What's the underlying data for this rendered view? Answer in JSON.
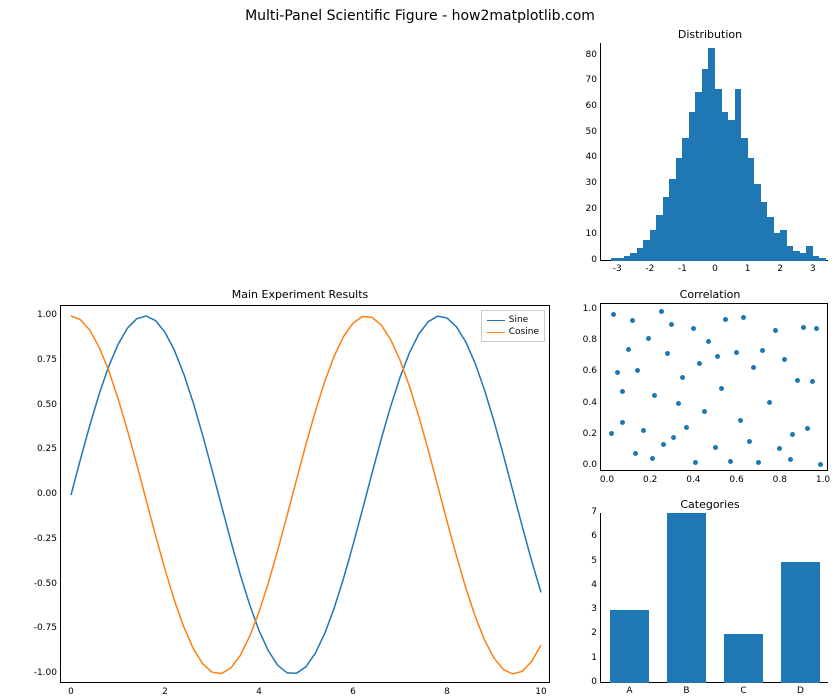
{
  "suptitle": "Multi-Panel Scientific Figure - how2matplotlib.com",
  "chart_data": [
    {
      "type": "line",
      "title": "Main Experiment Results",
      "xlabel": "",
      "ylabel": "",
      "xlim": [
        0,
        10
      ],
      "ylim": [
        -1,
        1
      ],
      "xticks": [
        0,
        2,
        4,
        6,
        8,
        10
      ],
      "yticks": [
        -1.0,
        -0.75,
        -0.5,
        -0.25,
        0.0,
        0.25,
        0.5,
        0.75,
        1.0
      ],
      "legend": [
        "Sine",
        "Cosine"
      ],
      "colors": {
        "Sine": "#1f77b4",
        "Cosine": "#ff7f0e"
      },
      "series": [
        {
          "name": "Sine",
          "x": [
            0,
            0.2,
            0.4,
            0.6,
            0.8,
            1,
            1.2,
            1.4,
            1.6,
            1.8,
            2,
            2.2,
            2.4,
            2.6,
            2.8,
            3,
            3.2,
            3.4,
            3.6,
            3.8,
            4,
            4.2,
            4.4,
            4.6,
            4.8,
            5,
            5.2,
            5.4,
            5.6,
            5.8,
            6,
            6.2,
            6.4,
            6.6,
            6.8,
            7,
            7.2,
            7.4,
            7.6,
            7.8,
            8,
            8.2,
            8.4,
            8.6,
            8.8,
            9,
            9.2,
            9.4,
            9.6,
            9.8,
            10
          ],
          "y": [
            0,
            0.199,
            0.389,
            0.565,
            0.717,
            0.841,
            0.932,
            0.985,
            1.0,
            0.974,
            0.909,
            0.808,
            0.675,
            0.516,
            0.335,
            0.141,
            -0.058,
            -0.256,
            -0.443,
            -0.612,
            -0.757,
            -0.871,
            -0.952,
            -0.994,
            -0.996,
            -0.959,
            -0.883,
            -0.773,
            -0.631,
            -0.465,
            -0.279,
            -0.083,
            0.117,
            0.312,
            0.494,
            0.657,
            0.794,
            0.899,
            0.968,
            0.999,
            0.989,
            0.94,
            0.855,
            0.735,
            0.585,
            0.412,
            0.223,
            0.024,
            -0.174,
            -0.367,
            -0.544
          ]
        },
        {
          "name": "Cosine",
          "x": [
            0,
            0.2,
            0.4,
            0.6,
            0.8,
            1,
            1.2,
            1.4,
            1.6,
            1.8,
            2,
            2.2,
            2.4,
            2.6,
            2.8,
            3,
            3.2,
            3.4,
            3.6,
            3.8,
            4,
            4.2,
            4.4,
            4.6,
            4.8,
            5,
            5.2,
            5.4,
            5.6,
            5.8,
            6,
            6.2,
            6.4,
            6.6,
            6.8,
            7,
            7.2,
            7.4,
            7.6,
            7.8,
            8,
            8.2,
            8.4,
            8.6,
            8.8,
            9,
            9.2,
            9.4,
            9.6,
            9.8,
            10
          ],
          "y": [
            1,
            0.98,
            0.921,
            0.825,
            0.697,
            0.54,
            0.362,
            0.17,
            -0.029,
            -0.227,
            -0.416,
            -0.589,
            -0.737,
            -0.857,
            -0.942,
            -0.99,
            -0.998,
            -0.967,
            -0.897,
            -0.79,
            -0.654,
            -0.49,
            -0.307,
            -0.112,
            0.087,
            0.284,
            0.469,
            0.635,
            0.776,
            0.886,
            0.96,
            0.997,
            0.993,
            0.95,
            0.869,
            0.754,
            0.608,
            0.439,
            0.252,
            0.054,
            -0.146,
            -0.339,
            -0.519,
            -0.678,
            -0.811,
            -0.911,
            -0.975,
            -1.0,
            -0.985,
            -0.93,
            -0.839
          ]
        }
      ]
    },
    {
      "type": "histogram",
      "title": "Distribution",
      "xlim": [
        -3.5,
        3.5
      ],
      "ylim": [
        0,
        85
      ],
      "xticks": [
        -3,
        -2,
        -1,
        0,
        1,
        2,
        3
      ],
      "yticks": [
        0,
        10,
        20,
        30,
        40,
        50,
        60,
        70,
        80
      ],
      "bins": [
        {
          "x0": -3.2,
          "x1": -3.0,
          "count": 1
        },
        {
          "x0": -3.0,
          "x1": -2.8,
          "count": 1
        },
        {
          "x0": -2.8,
          "x1": -2.6,
          "count": 2
        },
        {
          "x0": -2.6,
          "x1": -2.4,
          "count": 3
        },
        {
          "x0": -2.4,
          "x1": -2.2,
          "count": 5
        },
        {
          "x0": -2.2,
          "x1": -2.0,
          "count": 8
        },
        {
          "x0": -2.0,
          "x1": -1.8,
          "count": 12
        },
        {
          "x0": -1.8,
          "x1": -1.6,
          "count": 18
        },
        {
          "x0": -1.6,
          "x1": -1.4,
          "count": 25
        },
        {
          "x0": -1.4,
          "x1": -1.2,
          "count": 32
        },
        {
          "x0": -1.2,
          "x1": -1.0,
          "count": 40
        },
        {
          "x0": -1.0,
          "x1": -0.8,
          "count": 48
        },
        {
          "x0": -0.8,
          "x1": -0.6,
          "count": 58
        },
        {
          "x0": -0.6,
          "x1": -0.4,
          "count": 66
        },
        {
          "x0": -0.4,
          "x1": -0.2,
          "count": 75
        },
        {
          "x0": -0.2,
          "x1": 0.0,
          "count": 83
        },
        {
          "x0": 0.0,
          "x1": 0.2,
          "count": 67
        },
        {
          "x0": 0.2,
          "x1": 0.4,
          "count": 58
        },
        {
          "x0": 0.4,
          "x1": 0.6,
          "count": 55
        },
        {
          "x0": 0.6,
          "x1": 0.8,
          "count": 67
        },
        {
          "x0": 0.8,
          "x1": 1.0,
          "count": 48
        },
        {
          "x0": 1.0,
          "x1": 1.2,
          "count": 40
        },
        {
          "x0": 1.2,
          "x1": 1.4,
          "count": 30
        },
        {
          "x0": 1.4,
          "x1": 1.6,
          "count": 23
        },
        {
          "x0": 1.6,
          "x1": 1.8,
          "count": 17
        },
        {
          "x0": 1.8,
          "x1": 2.0,
          "count": 11
        },
        {
          "x0": 2.0,
          "x1": 2.2,
          "count": 12
        },
        {
          "x0": 2.2,
          "x1": 2.4,
          "count": 6
        },
        {
          "x0": 2.4,
          "x1": 2.6,
          "count": 4
        },
        {
          "x0": 2.6,
          "x1": 2.8,
          "count": 3
        },
        {
          "x0": 2.8,
          "x1": 3.0,
          "count": 6
        },
        {
          "x0": 3.0,
          "x1": 3.2,
          "count": 2
        },
        {
          "x0": 3.2,
          "x1": 3.4,
          "count": 1
        }
      ]
    },
    {
      "type": "scatter",
      "title": "Correlation",
      "xlim": [
        0,
        1
      ],
      "ylim": [
        0,
        1
      ],
      "xticks": [
        0.0,
        0.2,
        0.4,
        0.6,
        0.8,
        1.0
      ],
      "yticks": [
        0.0,
        0.2,
        0.4,
        0.6,
        0.8,
        1.0
      ],
      "points": [
        [
          0.02,
          0.21
        ],
        [
          0.03,
          0.97
        ],
        [
          0.05,
          0.6
        ],
        [
          0.07,
          0.48
        ],
        [
          0.07,
          0.28
        ],
        [
          0.1,
          0.75
        ],
        [
          0.12,
          0.93
        ],
        [
          0.13,
          0.08
        ],
        [
          0.14,
          0.61
        ],
        [
          0.17,
          0.23
        ],
        [
          0.19,
          0.82
        ],
        [
          0.21,
          0.05
        ],
        [
          0.22,
          0.45
        ],
        [
          0.25,
          0.99
        ],
        [
          0.26,
          0.14
        ],
        [
          0.28,
          0.72
        ],
        [
          0.3,
          0.91
        ],
        [
          0.31,
          0.18
        ],
        [
          0.33,
          0.4
        ],
        [
          0.35,
          0.57
        ],
        [
          0.37,
          0.25
        ],
        [
          0.4,
          0.88
        ],
        [
          0.41,
          0.02
        ],
        [
          0.43,
          0.66
        ],
        [
          0.45,
          0.35
        ],
        [
          0.47,
          0.8
        ],
        [
          0.5,
          0.12
        ],
        [
          0.51,
          0.7
        ],
        [
          0.53,
          0.5
        ],
        [
          0.55,
          0.94
        ],
        [
          0.57,
          0.03
        ],
        [
          0.6,
          0.73
        ],
        [
          0.62,
          0.29
        ],
        [
          0.63,
          0.95
        ],
        [
          0.66,
          0.16
        ],
        [
          0.68,
          0.63
        ],
        [
          0.7,
          0.02
        ],
        [
          0.72,
          0.74
        ],
        [
          0.75,
          0.41
        ],
        [
          0.78,
          0.87
        ],
        [
          0.8,
          0.11
        ],
        [
          0.82,
          0.68
        ],
        [
          0.85,
          0.04
        ],
        [
          0.86,
          0.2
        ],
        [
          0.88,
          0.55
        ],
        [
          0.91,
          0.89
        ],
        [
          0.93,
          0.24
        ],
        [
          0.95,
          0.54
        ],
        [
          0.97,
          0.88
        ],
        [
          0.99,
          0.01
        ]
      ]
    },
    {
      "type": "bar",
      "title": "Categories",
      "ylim": [
        0,
        7
      ],
      "yticks": [
        0,
        1,
        2,
        3,
        4,
        5,
        6,
        7
      ],
      "categories": [
        "A",
        "B",
        "C",
        "D"
      ],
      "values": [
        3,
        7,
        2,
        5
      ]
    }
  ]
}
